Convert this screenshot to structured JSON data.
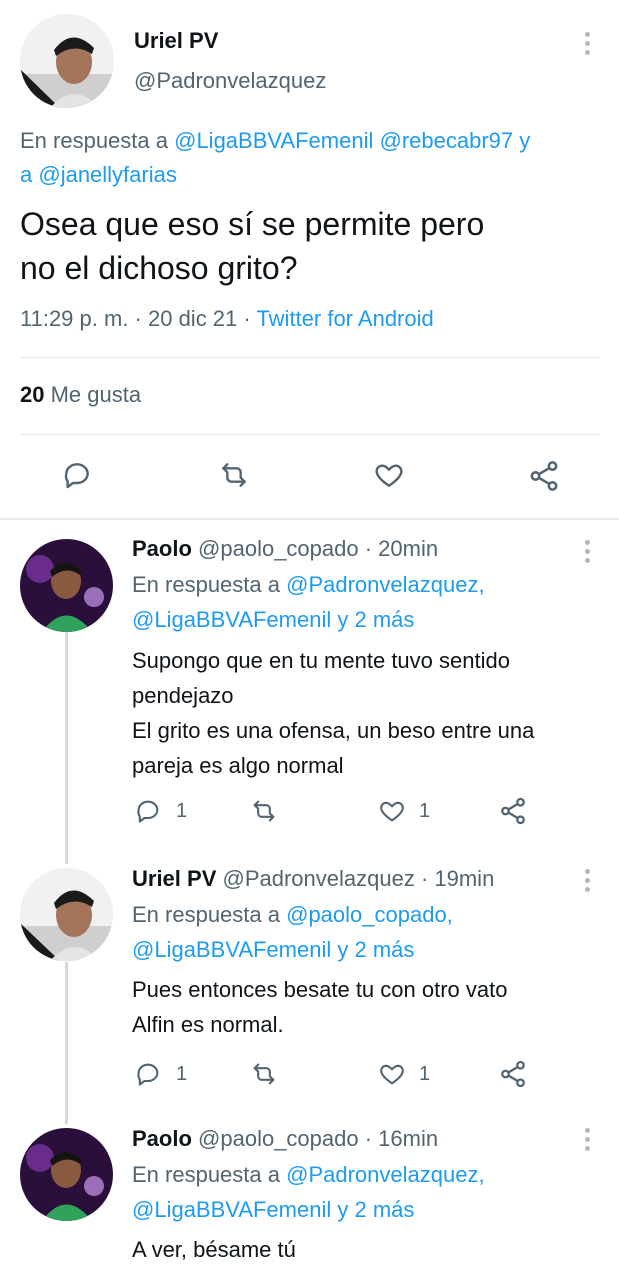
{
  "main_tweet": {
    "name": "Uriel PV",
    "handle": "@Padronvelazquez",
    "reply_prefix": "En respuesta a ",
    "reply_mention_1": "@LigaBBVAFemenil",
    "reply_mention_2": "@rebecabr97",
    "reply_and_1": " y",
    "reply_and_2": "a ",
    "reply_mention_3": "@janellyfarias",
    "text_line_1": "Osea que eso sí se permite pero",
    "text_line_2": "no el dichoso grito?",
    "meta_time": "11:29 p. m. · 20 dic 21 · ",
    "meta_source": "Twitter for Android",
    "likes_count": "20",
    "likes_label": " Me gusta"
  },
  "replies": [
    {
      "name": "Paolo",
      "handle": "@paolo_copado · 20min",
      "reply_prefix": "En respuesta a ",
      "reply_mention_1": "@Padronvelazquez,",
      "reply_mention_2": "@LigaBBVAFemenil",
      "reply_suffix": " y ",
      "reply_more": "2 más",
      "lines": [
        "Supongo que en tu mente tuvo sentido",
        "pendejazo",
        "El grito es una ofensa, un beso entre una",
        "pareja es algo normal"
      ],
      "reply_count": "1",
      "like_count": "1"
    },
    {
      "name": "Uriel PV",
      "handle": "@Padronvelazquez · 19min",
      "reply_prefix": "En respuesta a ",
      "reply_mention_1": "@paolo_copado,",
      "reply_mention_2": "@LigaBBVAFemenil",
      "reply_suffix": " y ",
      "reply_more": "2 más",
      "lines": [
        "Pues entonces besate tu con otro vato",
        "Alfin es normal."
      ],
      "reply_count": "1",
      "like_count": "1"
    },
    {
      "name": "Paolo",
      "handle": "@paolo_copado · 16min",
      "reply_prefix": "En respuesta a ",
      "reply_mention_1": "@Padronvelazquez,",
      "reply_mention_2": "@LigaBBVAFemenil",
      "reply_suffix": " y ",
      "reply_more": "2 más",
      "lines": [
        "A ver, bésame tú"
      ]
    }
  ],
  "icons": {
    "reply": "speech-bubble-icon",
    "retweet": "retweet-icon",
    "like": "heart-icon",
    "share": "share-icon",
    "more": "more-vertical-icon"
  },
  "colors": {
    "link": "#1d9bf0",
    "muted": "#536471",
    "text": "#0f1419",
    "divider": "#e6ecf0"
  }
}
